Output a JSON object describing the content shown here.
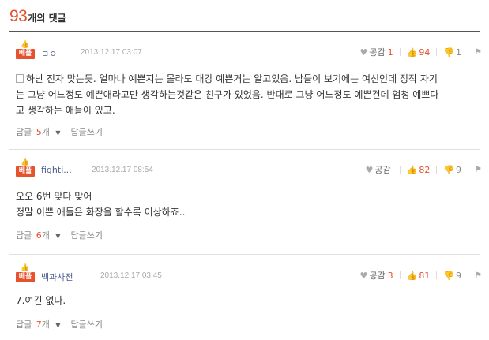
{
  "header": {
    "count": "93",
    "label": "개의 댓글"
  },
  "comments": [
    {
      "badge": "베플",
      "nick": "ㅁㅇ",
      "date": "2013.12.17 03:07",
      "empathy_label": "공감",
      "empathy_count": "1",
      "likes": "94",
      "dislikes": "1",
      "lines": [
        "하난 진자 맞는듯. 얼마나 예쁜지는 몰라도 대강 예쁜거는 알고있음. 남들이 보기에는 여신인데 정작 자기",
        "는 그냥 어느정도 예쁜애라고만 생각하는것같은 친구가 있었음. 반대로 그냥 어느정도 예쁜건데 엄청 예쁘다",
        "고 생각하는 애들이 있고."
      ],
      "reply_label": "답글",
      "reply_count": "5",
      "reply_suffix": "개",
      "write_label": "답글쓰기"
    },
    {
      "badge": "베플",
      "nick": "fighti...",
      "date": "2013.12.17 08:54",
      "empathy_label": "공감",
      "empathy_count": "",
      "likes": "82",
      "dislikes": "9",
      "lines": [
        "오오 6번 맞다 맞어",
        "정말 이쁜 애들은 화장을 할수록 이상하죠.."
      ],
      "reply_label": "답글",
      "reply_count": "6",
      "reply_suffix": "개",
      "write_label": "답글쓰기"
    },
    {
      "badge": "베플",
      "nick": "백과사전",
      "date": "2013.12.17 03:45",
      "empathy_label": "공감",
      "empathy_count": "3",
      "likes": "81",
      "dislikes": "9",
      "lines": [
        "7.여긴 없다."
      ],
      "reply_label": "답글",
      "reply_count": "7",
      "reply_suffix": "개",
      "write_label": "답글쓰기"
    }
  ],
  "icons": {
    "thumb": "thumbs-up-icon",
    "heart": "heart-icon",
    "like": "like-icon",
    "dislike": "dislike-icon",
    "report": "report-icon",
    "caret": "caret-down-icon",
    "memo": "memo-icon"
  },
  "colors": {
    "accent": "#e4522e",
    "nick": "#4a5a8a",
    "meta": "#aaaaaa"
  }
}
